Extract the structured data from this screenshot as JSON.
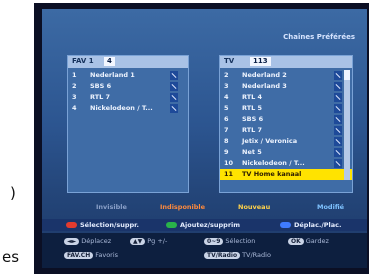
{
  "outside": {
    "top_char": ")",
    "bottom_text": "es"
  },
  "screen": {
    "title": "Chaînes Préférées"
  },
  "left_panel": {
    "header_label": "FAV 1",
    "count": "4",
    "rows": [
      {
        "num": "1",
        "name": "Nederland 1"
      },
      {
        "num": "2",
        "name": "SBS 6"
      },
      {
        "num": "3",
        "name": "RTL 7"
      },
      {
        "num": "4",
        "name": "Nickelodeon / T..."
      }
    ]
  },
  "right_panel": {
    "header_label": "TV",
    "count": "113",
    "selected_index": 10,
    "rows": [
      {
        "num": "2",
        "name": "Nederland 2"
      },
      {
        "num": "3",
        "name": "Nederland 3"
      },
      {
        "num": "4",
        "name": "RTL 4"
      },
      {
        "num": "5",
        "name": "RTL 5"
      },
      {
        "num": "6",
        "name": "SBS 6"
      },
      {
        "num": "7",
        "name": "RTL 7"
      },
      {
        "num": "8",
        "name": "Jetix / Veronica"
      },
      {
        "num": "9",
        "name": "Net 5"
      },
      {
        "num": "10",
        "name": "Nickelodeon / T..."
      },
      {
        "num": "11",
        "name": "TV Home kanaal"
      }
    ]
  },
  "tabs": [
    {
      "label": "Invisible",
      "color": "#8aa0c8"
    },
    {
      "label": "Indisponible",
      "color": "#ff8a3c"
    },
    {
      "label": "Nouveau",
      "color": "#ffd24a"
    },
    {
      "label": "Modifié",
      "color": "#7fc3ff"
    }
  ],
  "color_buttons": [
    {
      "label": "Sélection/suppr.",
      "color": "#e23b2f"
    },
    {
      "label": "Ajoutez/supprim",
      "color": "#29b34a"
    },
    {
      "label": "Déplac./Plac.",
      "color": "#3f7bff"
    }
  ],
  "help": [
    {
      "key": "◄►",
      "label": "Déplacez"
    },
    {
      "key": "▲▼",
      "label": "Pg +/-"
    },
    {
      "key": "0~9",
      "label": "Sélection"
    },
    {
      "key": "OK",
      "label": "Gardez"
    },
    {
      "key": "FAV.CH",
      "label": "Favoris"
    },
    {
      "key": "TV/Radio",
      "label": "TV/Radio"
    }
  ]
}
